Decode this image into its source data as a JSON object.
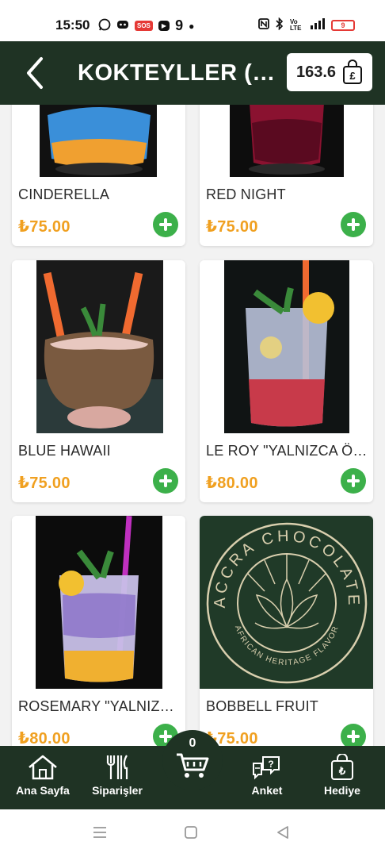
{
  "status_bar": {
    "time": "15:50",
    "notification_icons": [
      "whatsapp-icon",
      "discord-icon",
      "sos-icon",
      "youtube-icon",
      "nine-icon",
      "dot-icon"
    ],
    "sos_label": "SOS",
    "nine_label": "9",
    "system_icons": [
      "nfc-icon",
      "bluetooth-icon",
      "volte-icon",
      "signal-icon",
      "battery-icon"
    ],
    "volte_label": "Vo LTE",
    "battery_level": "9"
  },
  "header": {
    "title": "KOKTEYLLER (ALKOLLÜ)",
    "cart_total": "163.6",
    "bag_symbol": "£"
  },
  "products": [
    {
      "name": "CINDERELLA",
      "price": "₺75.00"
    },
    {
      "name": "RED NIGHT",
      "price": "₺75.00"
    },
    {
      "name": "BLUE HAWAII",
      "price": "₺75.00"
    },
    {
      "name": "LE ROY \"YALNIZCA ÖĞLE MENÜSÜ\"",
      "price": "₺80.00"
    },
    {
      "name": "ROSEMARY \"YALNIZCA ÖĞLE MENÜSÜ\"",
      "price": "₺80.00"
    },
    {
      "name": "BOBBELL FRUIT",
      "price": "₺75.00"
    }
  ],
  "brand_logo": {
    "top_text": "ACCRA CHOCOLATE",
    "bottom_text": "AFRICAN HERITAGE FLAVOR"
  },
  "bottom_nav": {
    "home": "Ana Sayfa",
    "orders": "Siparişler",
    "cart_count": "0",
    "survey": "Anket",
    "gift": "Hediye",
    "gift_symbol": "₺",
    "survey_symbol": "?"
  },
  "colors": {
    "header_bg": "#1f3324",
    "price": "#f0a020",
    "add_button": "#3cb04a",
    "brand_bg": "#203a28",
    "brand_gold": "#d9cfae"
  }
}
